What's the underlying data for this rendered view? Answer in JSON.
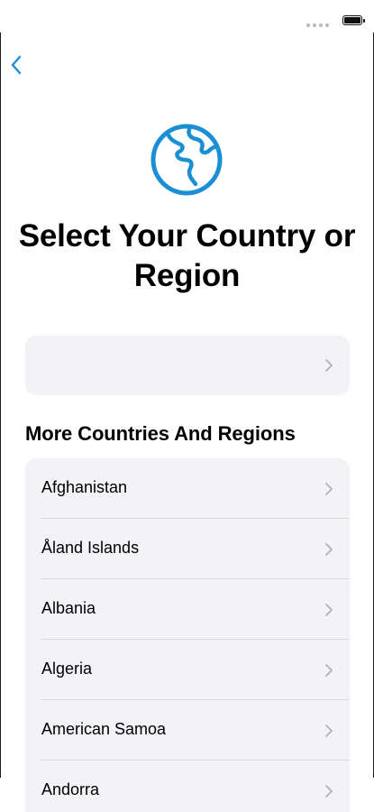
{
  "status_bar": {
    "signal": "signal-dots-icon",
    "battery": "battery-icon"
  },
  "nav": {
    "back_icon": "chevron-left-icon",
    "accent_color": "#1a8fd4"
  },
  "header": {
    "icon": "globe-icon",
    "title": "Select Your Country or Region"
  },
  "suggested": {
    "label": "",
    "chevron": "chevron-right-icon"
  },
  "more_section": {
    "title": "More Countries And Regions",
    "items": [
      {
        "label": "Afghanistan"
      },
      {
        "label": "Åland Islands"
      },
      {
        "label": "Albania"
      },
      {
        "label": "Algeria"
      },
      {
        "label": "American Samoa"
      },
      {
        "label": "Andorra"
      }
    ]
  },
  "colors": {
    "card_background": "#f3f3f7",
    "chevron": "#b0b0b6",
    "separator": "#d9d9de"
  }
}
